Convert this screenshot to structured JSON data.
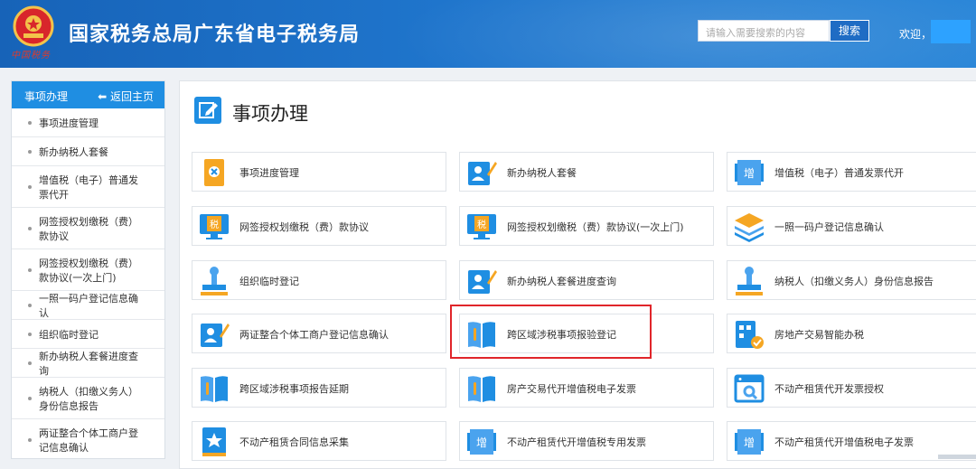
{
  "header": {
    "title": "国家税务总局广东省电子税务局",
    "emblem_text": "中国税务",
    "search_placeholder": "请输入需要搜索的内容",
    "search_button": "搜索",
    "welcome": "欢迎，"
  },
  "sidebar": {
    "title": "事项办理",
    "back_label": "返回主页",
    "items": [
      {
        "label": "事项进度管理"
      },
      {
        "label": "新办纳税人套餐"
      },
      {
        "label": "增值税（电子）普通发票代开"
      },
      {
        "label": "网签授权划缴税（费）款协议"
      },
      {
        "label": "网签授权划缴税（费）款协议(一次上门)"
      },
      {
        "label": "一照一码户登记信息确认"
      },
      {
        "label": "组织临时登记"
      },
      {
        "label": "新办纳税人套餐进度查询"
      },
      {
        "label": "纳税人（扣缴义务人）身份信息报告"
      },
      {
        "label": "两证整合个体工商户登记信息确认"
      }
    ]
  },
  "main": {
    "title": "事项办理",
    "cards": [
      {
        "label": "事项进度管理",
        "icon": "progress-doc-icon"
      },
      {
        "label": "新办纳税人套餐",
        "icon": "user-pen-icon"
      },
      {
        "label": "增值税（电子）普通发票代开",
        "icon": "invoice-zeng-icon"
      },
      {
        "label": "网签授权划缴税（费）款协议",
        "icon": "monitor-tax-icon"
      },
      {
        "label": "网签授权划缴税（费）款协议(一次上门)",
        "icon": "monitor-tax-icon"
      },
      {
        "label": "一照一码户登记信息确认",
        "icon": "layers-icon"
      },
      {
        "label": "组织临时登记",
        "icon": "stamp-icon"
      },
      {
        "label": "新办纳税人套餐进度查询",
        "icon": "user-pen-icon"
      },
      {
        "label": "纳税人（扣缴义务人）身份信息报告",
        "icon": "stamp-icon"
      },
      {
        "label": "两证整合个体工商户登记信息确认",
        "icon": "user-pen-icon"
      },
      {
        "label": "跨区域涉税事项报验登记",
        "icon": "book-icon"
      },
      {
        "label": "房地产交易智能办税",
        "icon": "building-check-icon"
      },
      {
        "label": "跨区域涉税事项报告延期",
        "icon": "book-icon"
      },
      {
        "label": "房产交易代开增值税电子发票",
        "icon": "book-icon"
      },
      {
        "label": "不动产租赁代开发票授权",
        "icon": "window-search-icon"
      },
      {
        "label": "不动产租赁合同信息采集",
        "icon": "star-book-icon"
      },
      {
        "label": "不动产租赁代开增值税专用发票",
        "icon": "invoice-zeng-icon"
      },
      {
        "label": "不动产租赁代开增值税电子发票",
        "icon": "invoice-zeng-icon"
      }
    ]
  },
  "colors": {
    "header_blue": "#1763b8",
    "accent_blue": "#1f8ee2",
    "icon_orange": "#f5a623",
    "highlight_red": "#e0252a"
  }
}
